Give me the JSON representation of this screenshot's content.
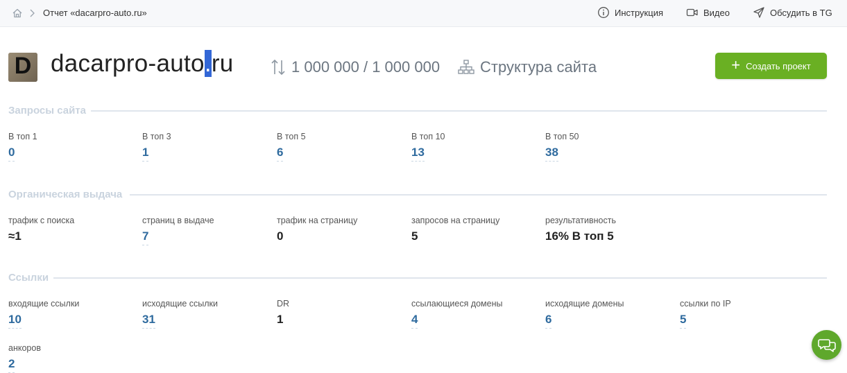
{
  "breadcrumb": {
    "title": "Отчет «dacarpro-auto.ru»"
  },
  "topbar": {
    "instruction": "Инструкция",
    "video": "Видео",
    "discuss": "Обсудить в TG"
  },
  "header": {
    "logo_letter": "D",
    "domain_prefix": "dacarpro-auto",
    "domain_selected": ".",
    "domain_suffix": "ru",
    "limit": "1 000 000 / 1 000 000",
    "structure": "Структура сайта",
    "create_button": "Создать проект"
  },
  "sections": {
    "queries": {
      "title": "Запросы сайта",
      "items": [
        {
          "label": "В топ 1",
          "value": "0"
        },
        {
          "label": "В топ 3",
          "value": "1"
        },
        {
          "label": "В топ 5",
          "value": "6"
        },
        {
          "label": "В топ 10",
          "value": "13"
        },
        {
          "label": "В топ 50",
          "value": "38"
        }
      ]
    },
    "organic": {
      "title": "Органическая выдача",
      "items": [
        {
          "label": "трафик с поиска",
          "value": "≈1"
        },
        {
          "label": "страниц в выдаче",
          "value": "7"
        },
        {
          "label": "трафик на страницу",
          "value": "0"
        },
        {
          "label": "запросов на страницу",
          "value": "5"
        },
        {
          "label": "результативность",
          "value": "16% В топ 5"
        }
      ]
    },
    "links": {
      "title": "Ссылки",
      "items": [
        {
          "label": "входящие ссылки",
          "value": "10"
        },
        {
          "label": "исходящие ссылки",
          "value": "31"
        },
        {
          "label": "DR",
          "value": "1"
        },
        {
          "label": "ссылающиеся домены",
          "value": "4"
        },
        {
          "label": "исходящие домены",
          "value": "6"
        },
        {
          "label": "ссылки по IP",
          "value": "5"
        },
        {
          "label": "анкоров",
          "value": "2"
        }
      ]
    }
  },
  "colors": {
    "accent_green": "#6ab023",
    "link_blue": "#2e6a9e",
    "section_title": "#c9d3de",
    "selection": "#3367d6"
  },
  "icons": [
    "home-icon",
    "chevron-right-icon",
    "info-icon",
    "video-icon",
    "send-icon",
    "sort-arrows-icon",
    "sitemap-icon",
    "plus-icon",
    "chat-icon"
  ]
}
